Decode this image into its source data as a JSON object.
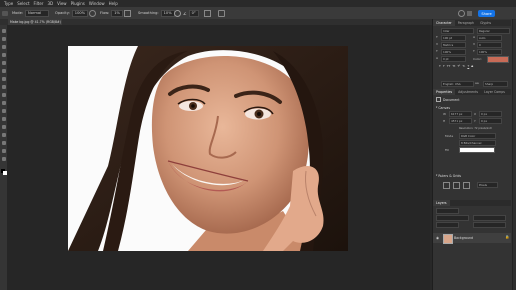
{
  "menu": [
    "Type",
    "Select",
    "Filter",
    "3D",
    "View",
    "Plugins",
    "Window",
    "Help"
  ],
  "options": {
    "mode_label": "Mode:",
    "mode_value": "Normal",
    "opacity_label": "Opacity:",
    "opacity_value": "100%",
    "flow_label": "Flow:",
    "flow_value": "1%",
    "smoothing_label": "Smoothing:",
    "smoothing_value": "10%",
    "angle_value": "0°",
    "share_label": "Share"
  },
  "document": {
    "tab_title": "Make bg.jpg @ 41.7% (RGB/8#)"
  },
  "panels": {
    "top_tabs": [
      "Character",
      "Paragraph",
      "Glyphs"
    ],
    "character": {
      "font": "Inter",
      "style": "Regular",
      "size": "100 pt",
      "leading": "Auto",
      "tracking_label": "Metrics",
      "tracking": "0",
      "scale_v": "100%",
      "scale_h": "100%",
      "baseline": "0 pt",
      "color_label": "Color:",
      "language": "English: USA",
      "aa": "Sharp"
    },
    "mid_tabs": [
      "Properties",
      "Adjustments",
      "Layer Comps"
    ],
    "properties": {
      "doc_label": "Document",
      "canvas_title": "Canvas",
      "w_value": "6177 px",
      "h_value": "4571 px",
      "x_value": "0 px",
      "y_value": "0 px",
      "resolution": "Resolution: 72 pixels/inch",
      "mode_label": "Mode",
      "mode_value": "RGB Color",
      "depth_value": "8 Bits/Channel",
      "fill_label": "Fill",
      "rulers_title": "Rulers & Grids",
      "units_value": "Pixels"
    },
    "layers": {
      "tab": "Layers",
      "layer_name": "Background"
    }
  }
}
